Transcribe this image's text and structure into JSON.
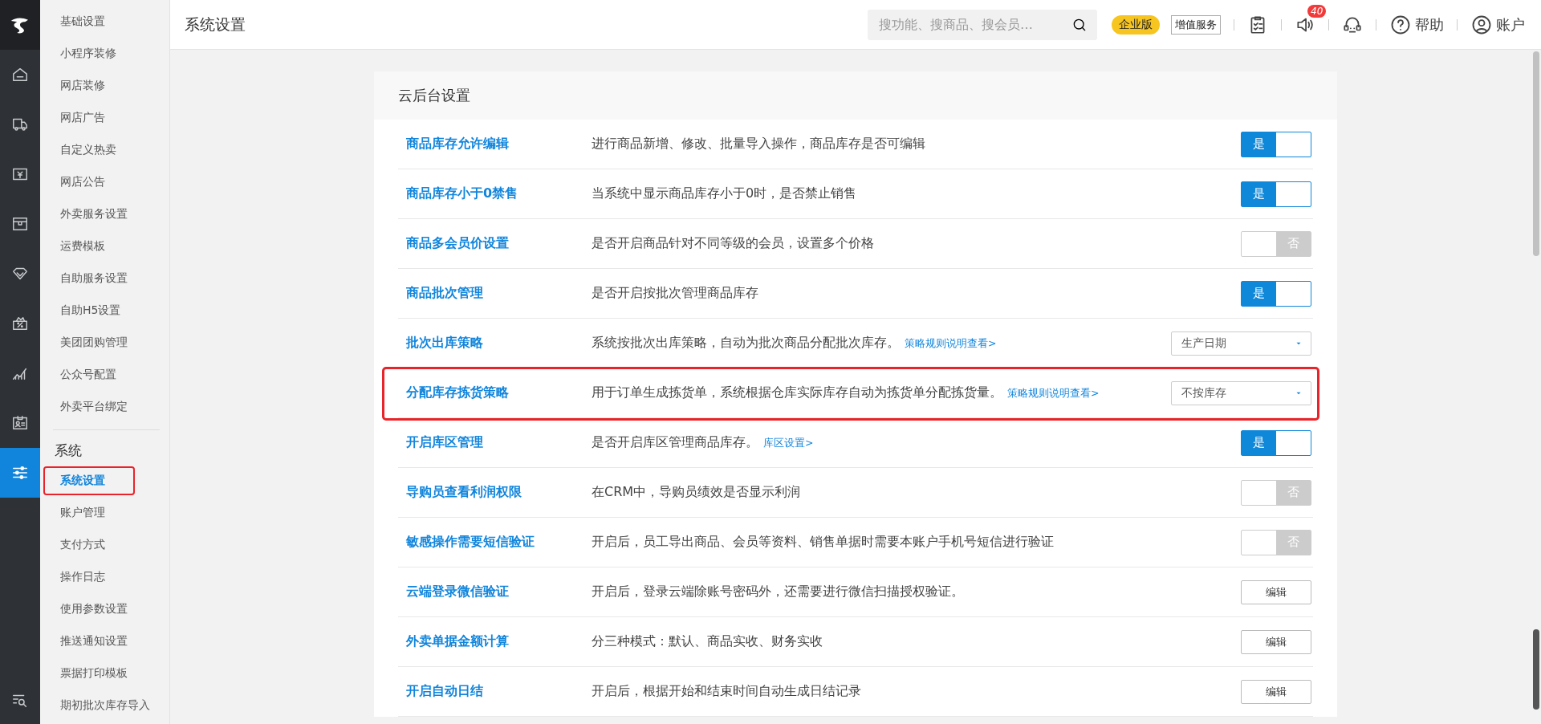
{
  "rail": {
    "items": [
      {
        "selected": false
      },
      {
        "selected": false
      },
      {
        "selected": false
      },
      {
        "selected": false
      },
      {
        "selected": false
      },
      {
        "selected": false
      },
      {
        "selected": false
      },
      {
        "selected": false
      },
      {
        "selected": true
      }
    ]
  },
  "subnav": {
    "sections": [
      {
        "items": [
          {
            "label": "基础设置",
            "selected": false,
            "highlighted": false
          },
          {
            "label": "小程序装修",
            "selected": false,
            "highlighted": false
          },
          {
            "label": "网店装修",
            "selected": false,
            "highlighted": false
          },
          {
            "label": "网店广告",
            "selected": false,
            "highlighted": false
          },
          {
            "label": "自定义热卖",
            "selected": false,
            "highlighted": false
          },
          {
            "label": "网店公告",
            "selected": false,
            "highlighted": false
          },
          {
            "label": "外卖服务设置",
            "selected": false,
            "highlighted": false
          },
          {
            "label": "运费模板",
            "selected": false,
            "highlighted": false
          },
          {
            "label": "自助服务设置",
            "selected": false,
            "highlighted": false
          },
          {
            "label": "自助H5设置",
            "selected": false,
            "highlighted": false
          },
          {
            "label": "美团团购管理",
            "selected": false,
            "highlighted": false
          },
          {
            "label": "公众号配置",
            "selected": false,
            "highlighted": false
          },
          {
            "label": "外卖平台绑定",
            "selected": false,
            "highlighted": false
          }
        ]
      },
      {
        "heading": "系统",
        "items": [
          {
            "label": "系统设置",
            "selected": true,
            "highlighted": true
          },
          {
            "label": "账户管理",
            "selected": false,
            "highlighted": false
          },
          {
            "label": "支付方式",
            "selected": false,
            "highlighted": false
          },
          {
            "label": "操作日志",
            "selected": false,
            "highlighted": false
          },
          {
            "label": "使用参数设置",
            "selected": false,
            "highlighted": false
          },
          {
            "label": "推送通知设置",
            "selected": false,
            "highlighted": false
          },
          {
            "label": "票据打印模板",
            "selected": false,
            "highlighted": false
          },
          {
            "label": "期初批次库存导入",
            "selected": false,
            "highlighted": false
          }
        ]
      }
    ]
  },
  "header": {
    "title": "系统设置",
    "search": {
      "placeholder": "搜功能、搜商品、搜会员…"
    },
    "edition_badge": "企业版",
    "service_button": "增值服务",
    "notification_count": "40",
    "help": "帮助",
    "account": "账户"
  },
  "card": {
    "title": "云后台设置",
    "rows": [
      {
        "label": "商品库存允许编辑",
        "description": "进行商品新增、修改、批量导入操作，商品库存是否可编辑",
        "kind": "toggle",
        "on": true,
        "state_label": "是",
        "highlighted": false
      },
      {
        "label": "商品库存小于0禁售",
        "description": "当系统中显示商品库存小于0时，是否禁止销售",
        "kind": "toggle",
        "on": true,
        "state_label": "是",
        "highlighted": false
      },
      {
        "label": "商品多会员价设置",
        "description": "是否开启商品针对不同等级的会员，设置多个价格",
        "kind": "toggle",
        "on": false,
        "state_label": "否",
        "highlighted": false
      },
      {
        "label": "商品批次管理",
        "description": "是否开启按批次管理商品库存",
        "kind": "toggle",
        "on": true,
        "state_label": "是",
        "highlighted": false
      },
      {
        "label": "批次出库策略",
        "description": "系统按批次出库策略，自动为批次商品分配批次库存。",
        "link": "策略规则说明查看>",
        "kind": "select",
        "value": "生产日期",
        "highlighted": false
      },
      {
        "label": "分配库存拣货策略",
        "description": "用于订单生成拣货单，系统根据仓库实际库存自动为拣货单分配拣货量。",
        "link": "策略规则说明查看>",
        "kind": "select",
        "value": "不按库存",
        "highlighted": true
      },
      {
        "label": "开启库区管理",
        "description": "是否开启库区管理商品库存。",
        "link": "库区设置>",
        "kind": "toggle",
        "on": true,
        "state_label": "是",
        "highlighted": false
      },
      {
        "label": "导购员查看利润权限",
        "description": "在CRM中，导购员绩效是否显示利润",
        "kind": "toggle",
        "on": false,
        "state_label": "否",
        "highlighted": false
      },
      {
        "label": "敏感操作需要短信验证",
        "description": "开启后，员工导出商品、会员等资料、销售单据时需要本账户手机号短信进行验证",
        "kind": "toggle",
        "on": false,
        "state_label": "否",
        "highlighted": false
      },
      {
        "label": "云端登录微信验证",
        "description": "开启后，登录云端除账号密码外，还需要进行微信扫描授权验证。",
        "kind": "button",
        "button": "编辑",
        "highlighted": false
      },
      {
        "label": "外卖单据金额计算",
        "description": "分三种模式：默认、商品实收、财务实收",
        "kind": "button",
        "button": "编辑",
        "highlighted": false
      },
      {
        "label": "开启自动日结",
        "description": "开启后，根据开始和结束时间自动生成日结记录",
        "kind": "button",
        "button": "编辑",
        "highlighted": false
      }
    ]
  }
}
